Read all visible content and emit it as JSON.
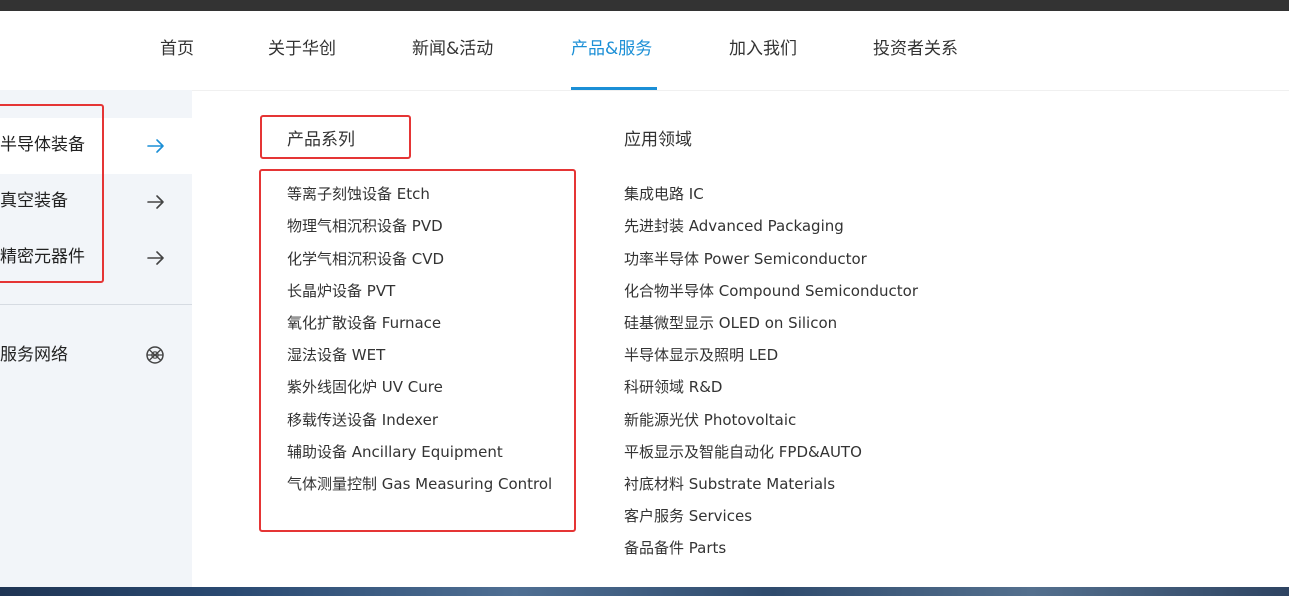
{
  "nav": {
    "items": [
      {
        "label": "首页"
      },
      {
        "label": "关于华创"
      },
      {
        "label": "新闻&活动"
      },
      {
        "label": "产品&服务"
      },
      {
        "label": "加入我们"
      },
      {
        "label": "投资者关系"
      }
    ],
    "active_index": 3,
    "accent_color": "#1b8fd6"
  },
  "sidebar": {
    "items": [
      {
        "label": "半导体装备",
        "icon": "arrow-right-icon",
        "active": true
      },
      {
        "label": "真空装备",
        "icon": "arrow-right-icon",
        "active": false
      },
      {
        "label": "精密元器件",
        "icon": "arrow-right-icon",
        "active": false
      }
    ],
    "service": {
      "label": "服务网络",
      "icon": "globe-icon"
    }
  },
  "products": {
    "title": "产品系列",
    "items": [
      "等离子刻蚀设备 Etch",
      "物理气相沉积设备 PVD",
      "化学气相沉积设备 CVD",
      "长晶炉设备 PVT",
      "氧化扩散设备 Furnace",
      "湿法设备 WET",
      "紫外线固化炉 UV Cure",
      "移载传送设备 Indexer",
      "辅助设备 Ancillary Equipment",
      "气体测量控制 Gas Measuring Control"
    ]
  },
  "applications": {
    "title": "应用领域",
    "items": [
      "集成电路 IC",
      "先进封装 Advanced Packaging",
      "功率半导体 Power Semiconductor",
      "化合物半导体 Compound Semiconductor",
      "硅基微型显示 OLED on Silicon",
      "半导体显示及照明 LED",
      "科研领域 R&D",
      "新能源光伏 Photovoltaic",
      "平板显示及智能自动化 FPD&AUTO",
      "衬底材料 Substrate Materials",
      "客户服务 Services",
      "备品备件 Parts"
    ]
  },
  "highlight_color": "#e53535"
}
